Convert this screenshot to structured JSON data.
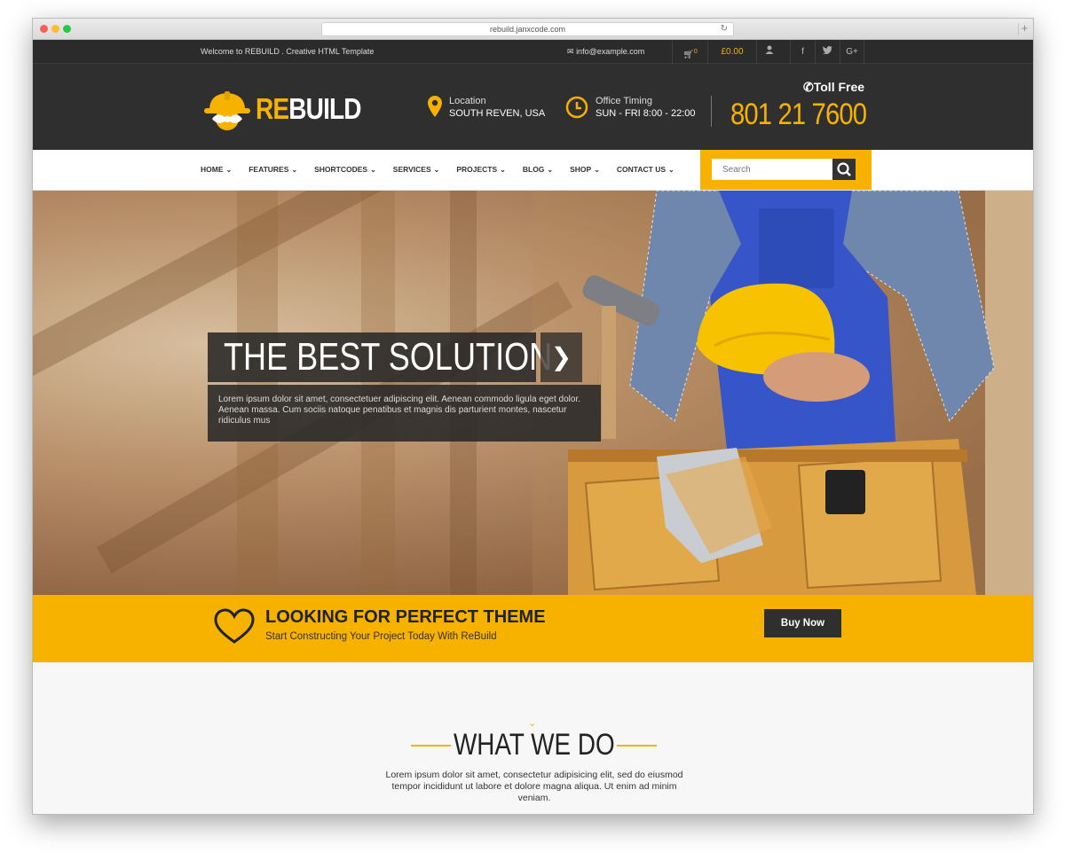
{
  "browser": {
    "url": "rebuild.janxcode.com"
  },
  "topbar": {
    "welcome": "Welcome to REBUILD . Creative HTML Template",
    "email": "info@example.com",
    "cart_count": "0",
    "cart_total": "£0.00",
    "social_icons": [
      "user-icon",
      "facebook-icon",
      "twitter-icon",
      "google-plus-icon"
    ]
  },
  "header": {
    "logo_re": "RE",
    "logo_build": "BUILD",
    "location_label": "Location",
    "location_value": "SOUTH REVEN, USA",
    "timing_label": "Office Timing",
    "timing_value": "SUN - FRI 8:00 - 22:00",
    "toll_free_label": "Toll Free",
    "phone": "801 21 7600"
  },
  "nav": {
    "items": [
      "HOME",
      "FEATURES",
      "SHORTCODES",
      "SERVICES",
      "PROJECTS",
      "BLOG",
      "SHOP",
      "CONTACT US"
    ],
    "search_placeholder": "Search"
  },
  "hero": {
    "title": "THE BEST SOLUTION",
    "text": "Lorem ipsum dolor sit amet, consectetuer adipiscing elit. Aenean commodo ligula eget dolor. Aenean massa. Cum sociis natoque penatibus et magnis dis parturient montes, nascetur ridiculus mus"
  },
  "cta": {
    "title": "LOOKING FOR PERFECT THEME",
    "subtitle": "Start Constructing Your Project Today With ReBuild",
    "button": "Buy Now"
  },
  "what_we_do": {
    "title": "WHAT WE DO",
    "text": "Lorem ipsum dolor sit amet, consectetur adipisicing elit, sed do eiusmod tempor incididunt ut labore et dolore magna aliqua. Ut enim ad minim veniam."
  },
  "colors": {
    "accent": "#f7b200",
    "dark": "#2f2f2f"
  }
}
